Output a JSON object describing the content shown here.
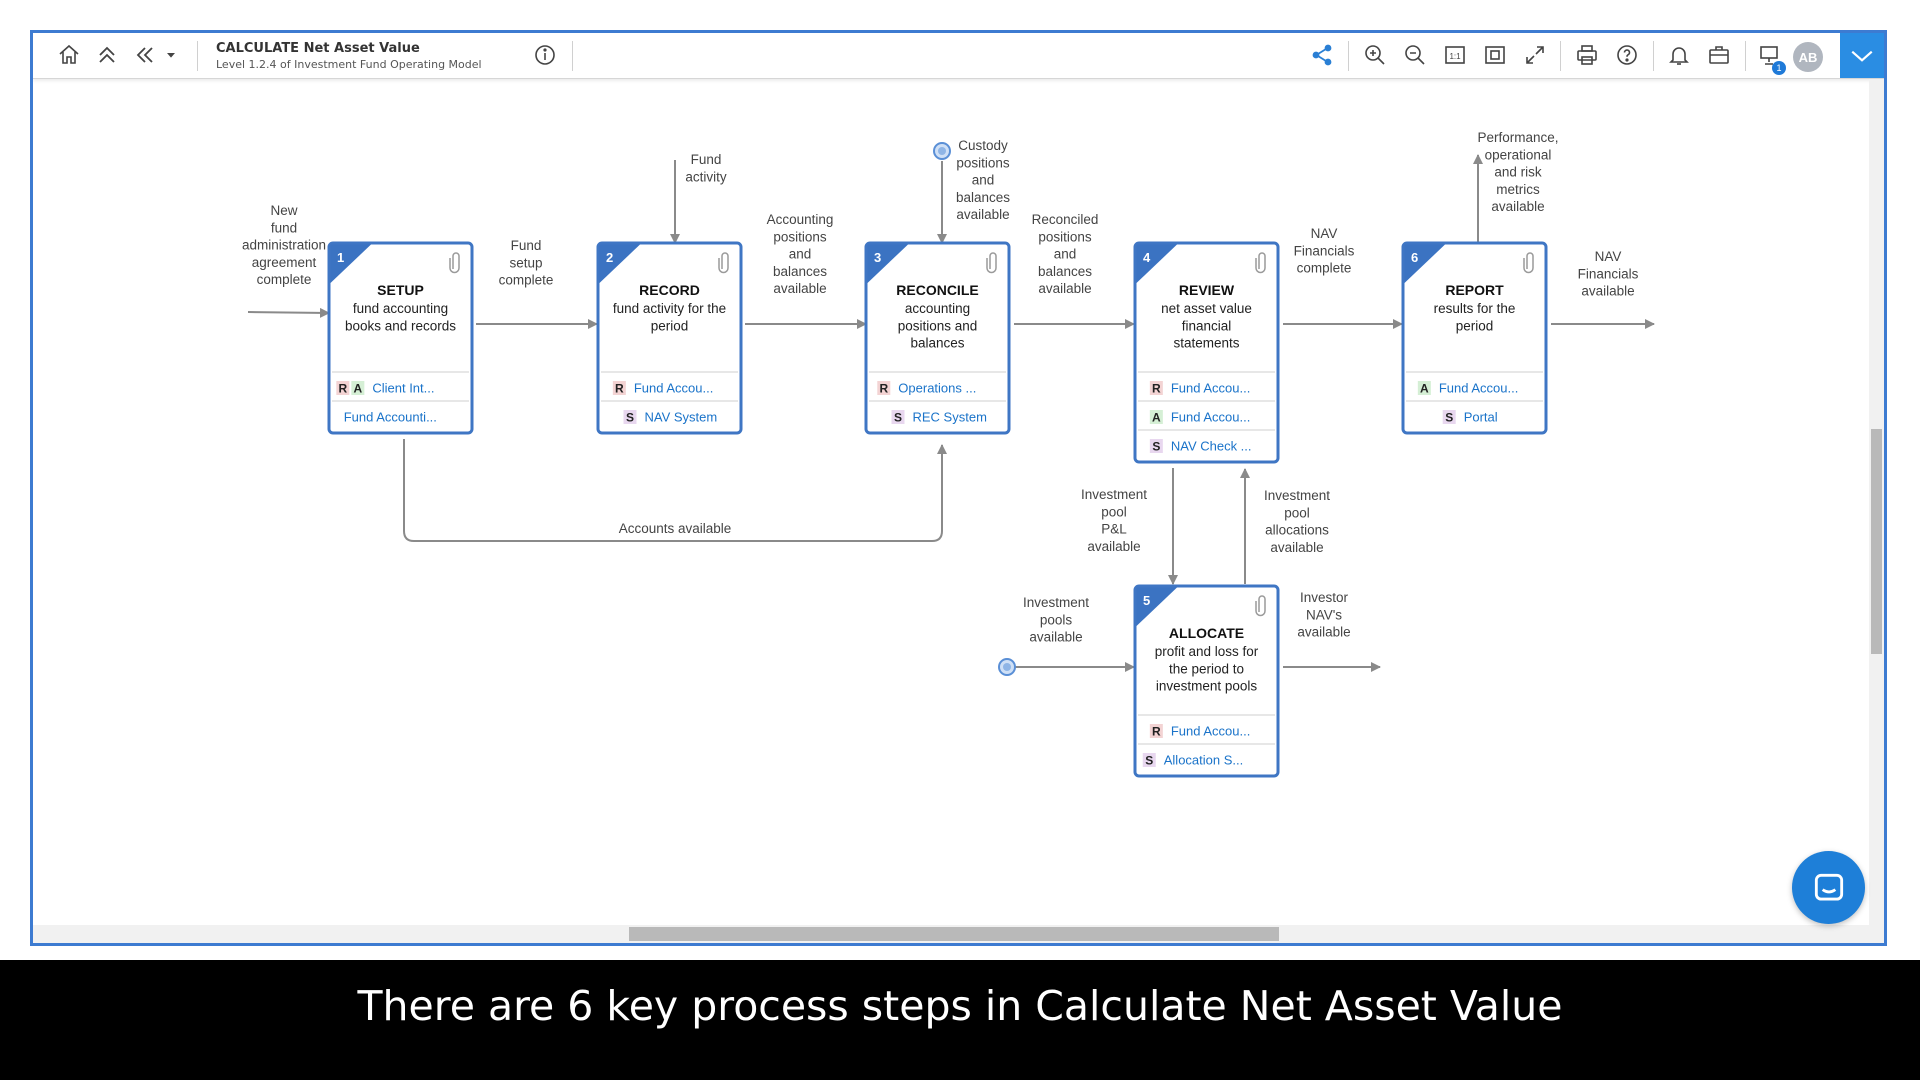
{
  "header": {
    "title": "CALCULATE Net Asset Value",
    "subtitle": "Level 1.2.4 of Investment Fund Operating Model",
    "avatar_initials": "AB",
    "notification_count": "1",
    "icons": [
      "home-icon",
      "chevrons-up-icon",
      "chevrons-left-icon",
      "caret-down-icon",
      "info-icon",
      "share-icon",
      "zoom-in-icon",
      "zoom-out-icon",
      "actual-size-icon",
      "fit-page-icon",
      "expand-icon",
      "print-icon",
      "help-icon",
      "bell-icon",
      "briefcase-icon",
      "present-icon",
      "collapse-chevron-icon"
    ]
  },
  "steps": [
    {
      "num": "1",
      "title": "SETUP",
      "desc": [
        "fund accounting",
        "books and records"
      ],
      "roles": [
        {
          "badges": [
            "R",
            "A"
          ],
          "label": "Client Int..."
        },
        {
          "badges": [],
          "label": "Fund Accounti..."
        }
      ]
    },
    {
      "num": "2",
      "title": "RECORD",
      "desc": [
        "fund activity for the",
        "period"
      ],
      "roles": [
        {
          "badges": [
            "R"
          ],
          "label": "Fund Accou..."
        },
        {
          "badges": [
            "S"
          ],
          "label": "NAV System"
        }
      ]
    },
    {
      "num": "3",
      "title": "RECONCILE",
      "desc": [
        "accounting",
        "positions and",
        "balances"
      ],
      "roles": [
        {
          "badges": [
            "R"
          ],
          "label": "Operations ..."
        },
        {
          "badges": [
            "S"
          ],
          "label": "REC System"
        }
      ]
    },
    {
      "num": "4",
      "title": "REVIEW",
      "desc": [
        "net asset value",
        "financial",
        "statements"
      ],
      "roles": [
        {
          "badges": [
            "R"
          ],
          "label": "Fund Accou..."
        },
        {
          "badges": [
            "A"
          ],
          "label": "Fund Accou..."
        },
        {
          "badges": [
            "S"
          ],
          "label": "NAV Check ..."
        }
      ]
    },
    {
      "num": "5",
      "title": "ALLOCATE",
      "desc": [
        "profit and loss for",
        "the period to",
        "investment pools"
      ],
      "roles": [
        {
          "badges": [
            "R"
          ],
          "label": "Fund Accou..."
        },
        {
          "badges": [
            "S"
          ],
          "label": "Allocation S..."
        }
      ]
    },
    {
      "num": "6",
      "title": "REPORT",
      "desc": [
        "results for the",
        "period"
      ],
      "roles": [
        {
          "badges": [
            "A"
          ],
          "label": "Fund Accou..."
        },
        {
          "badges": [
            "S"
          ],
          "label": "Portal"
        }
      ]
    }
  ],
  "flow_labels": {
    "new_fund": [
      "New",
      "fund",
      "administration",
      "agreement",
      "complete"
    ],
    "fund_setup": [
      "Fund",
      "setup",
      "complete"
    ],
    "fund_activity": [
      "Fund",
      "activity"
    ],
    "accounting_positions": [
      "Accounting",
      "positions",
      "and",
      "balances",
      "available"
    ],
    "custody_positions": [
      "Custody",
      "positions",
      "and",
      "balances",
      "available"
    ],
    "reconciled_positions": [
      "Reconciled",
      "positions",
      "and",
      "balances",
      "available"
    ],
    "nav_financials_complete": [
      "NAV",
      "Financials",
      "complete"
    ],
    "performance_metrics": [
      "Performance,",
      "operational",
      "and risk",
      "metrics",
      "available"
    ],
    "nav_financials_available": [
      "NAV",
      "Financials",
      "available"
    ],
    "accounts_available": [
      "Accounts available"
    ],
    "investment_pool_pl": [
      "Investment",
      "pool",
      "P&L",
      "available"
    ],
    "investment_pool_allocations": [
      "Investment",
      "pool",
      "allocations",
      "available"
    ],
    "investment_pools_available": [
      "Investment",
      "pools",
      "available"
    ],
    "investor_navs": [
      "Investor",
      "NAV's",
      "available"
    ]
  },
  "colors": {
    "accent": "#3d7bd1",
    "card_border": "#3f76c4",
    "link": "#1a73c9",
    "badge_R": "#f3d3d3",
    "badge_A": "#d5efd5",
    "badge_S": "#e8d7ef",
    "caption_bg": "#000000"
  },
  "caption": "There are 6 key process steps in Calculate Net Asset Value"
}
